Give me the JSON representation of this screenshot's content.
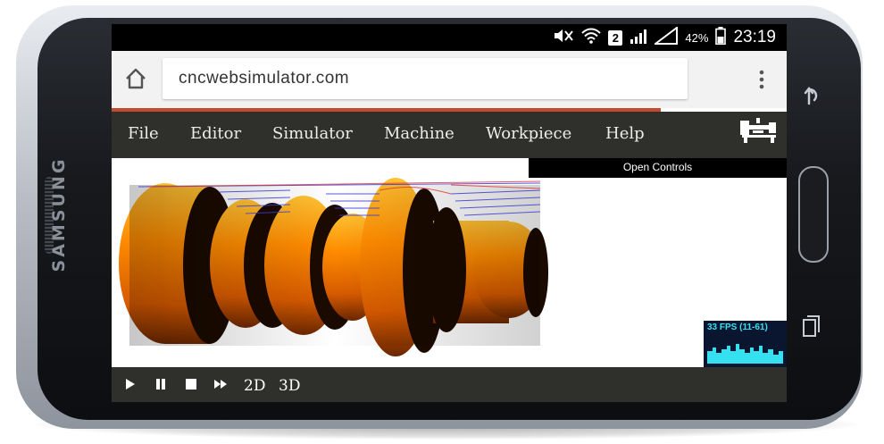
{
  "device": {
    "brand": "SAMSUNG"
  },
  "status_bar": {
    "sim_badge": "2",
    "battery": "42%",
    "time": "23:19"
  },
  "browser": {
    "url": "cncwebsimulator.com"
  },
  "menu": {
    "items": [
      "File",
      "Editor",
      "Simulator",
      "Machine",
      "Workpiece",
      "Help"
    ]
  },
  "viewport": {
    "open_controls": "Open Controls",
    "fps": "33 FPS (11-61)"
  },
  "transport": {
    "buttons": [
      "play-icon",
      "pause-icon",
      "stop-icon",
      "fast-forward-icon"
    ],
    "view_2d": "2D",
    "view_3d": "3D"
  },
  "colors": {
    "toolbar_bg": "#2f302b",
    "progress_accent": "#c34a2c",
    "workpiece_orange": "#ff8a00",
    "fps_cyan": "#35e0f0"
  }
}
